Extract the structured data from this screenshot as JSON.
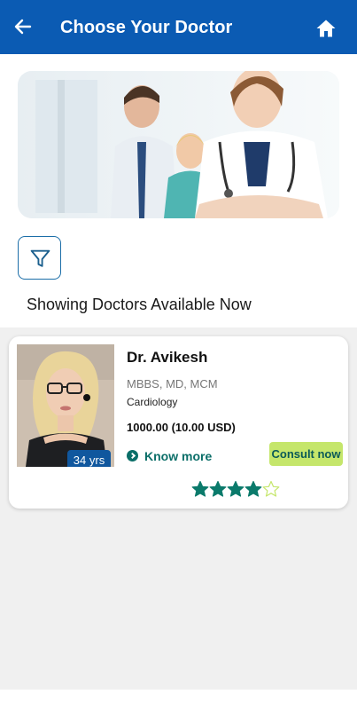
{
  "header": {
    "title": "Choose Your Doctor",
    "back_icon": "back-arrow-icon",
    "home_icon": "home-icon",
    "color": "#0b5bb3"
  },
  "filter": {
    "icon": "filter-icon"
  },
  "status_text": "Showing Doctors Available Now",
  "doctors": [
    {
      "name": "Dr. Avikesh",
      "age": "34 yrs",
      "degree": "MBBS, MD, MCM",
      "specialty": "Cardiology",
      "fee": "1000.00 (10.00 USD)",
      "know_more": "Know more",
      "consult": "Consult now",
      "rating": 4,
      "rating_max": 5
    }
  ],
  "colors": {
    "accent": "#0b6e68",
    "consult_bg": "#c5e66b",
    "star": "#0b7a6b"
  }
}
